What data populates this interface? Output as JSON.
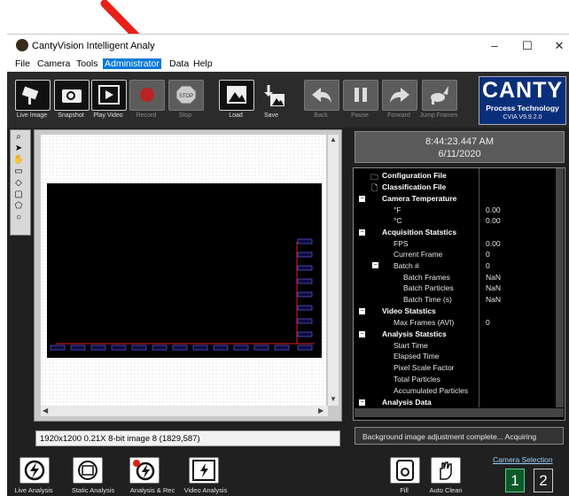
{
  "window": {
    "title": "CantyVision Intelligent Analy",
    "controls": {
      "minimize": "–",
      "maximize": "☐",
      "close": "✕"
    }
  },
  "menu": [
    "File",
    "Camera",
    "Tools",
    "Administrator",
    "Data",
    "Help"
  ],
  "toolbar": {
    "buttons": [
      {
        "label": "Live Image",
        "icon": "camera-icon",
        "enabled": true
      },
      {
        "label": "Snapshot",
        "icon": "snapshot-icon",
        "enabled": true
      },
      {
        "label": "Play Video",
        "icon": "film-icon",
        "enabled": true
      },
      {
        "label": "Record",
        "icon": "record-icon",
        "enabled": false
      },
      {
        "label": "Stop",
        "icon": "stop-icon",
        "enabled": false
      },
      {
        "label": "Load",
        "icon": "image-load-icon",
        "enabled": true
      },
      {
        "label": "Save",
        "icon": "image-save-icon",
        "enabled": true
      },
      {
        "label": "Back",
        "icon": "back-arrow-icon",
        "enabled": false
      },
      {
        "label": "Pause",
        "icon": "pause-icon",
        "enabled": false
      },
      {
        "label": "Forward",
        "icon": "forward-arrow-icon",
        "enabled": false
      },
      {
        "label": "Jump Frames",
        "icon": "rabbit-icon",
        "enabled": false
      }
    ]
  },
  "brand": {
    "name": "CANTY",
    "tagline": "Process Technology",
    "version": "CVIA V9.9.2.0"
  },
  "image_info": "1920x1200 0.21X 8-bit image 8  (1829,587)",
  "clock": {
    "time": "8:44:23.447 AM",
    "date": "6/11/2020"
  },
  "tree": [
    {
      "label": "Configuration File",
      "value": "",
      "bold": true
    },
    {
      "label": "Classification File",
      "value": "",
      "bold": true
    },
    {
      "label": "Camera Temperature",
      "value": "",
      "bold": true
    },
    {
      "label": "°F",
      "value": "0.00",
      "bold": false
    },
    {
      "label": "°C",
      "value": "0.00",
      "bold": false
    },
    {
      "label": "Acquisition Statstics",
      "value": "",
      "bold": true
    },
    {
      "label": "FPS",
      "value": "0.00",
      "bold": false
    },
    {
      "label": "Current Frame",
      "value": "0",
      "bold": false
    },
    {
      "label": "Batch #",
      "value": "0",
      "bold": false
    },
    {
      "label": "Batch Frames",
      "value": "NaN",
      "bold": false
    },
    {
      "label": "Batch Particles",
      "value": "NaN",
      "bold": false
    },
    {
      "label": "Batch Time (s)",
      "value": "NaN",
      "bold": false
    },
    {
      "label": "Video Statstics",
      "value": "",
      "bold": true
    },
    {
      "label": "Max Frames (AVI)",
      "value": "0",
      "bold": false
    },
    {
      "label": "Analysis Statstics",
      "value": "",
      "bold": true
    },
    {
      "label": "Start Time",
      "value": "",
      "bold": false
    },
    {
      "label": "Elapsed Time",
      "value": "",
      "bold": false
    },
    {
      "label": "Pixel Scale Factor",
      "value": "",
      "bold": false
    },
    {
      "label": "Total Particles",
      "value": "",
      "bold": false
    },
    {
      "label": "Accumulated Particles",
      "value": "",
      "bold": false
    },
    {
      "label": "Analysis Data",
      "value": "",
      "bold": true
    }
  ],
  "status_message": "Background image adjustment complete... Acquiring",
  "bottom": {
    "buttons": [
      "Live Analysis",
      "Static Analysis",
      "Analysis & Rec",
      "Video Analysis"
    ],
    "right_buttons": [
      "Fill",
      "Auto Clean"
    ],
    "camera_selection": "Camera Selection",
    "cameras": [
      "1",
      "2"
    ]
  },
  "colors": {
    "accent": "#0078d7",
    "annotation_arrow": "#e8201a",
    "brand_bg": "#0a2f7a",
    "app_bg": "#202020"
  }
}
